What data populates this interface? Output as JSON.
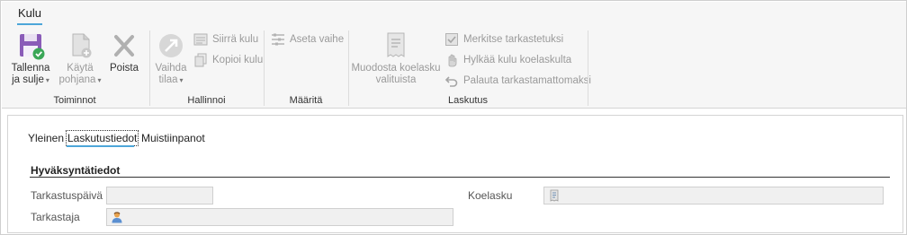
{
  "ribbon": {
    "tab": "Kulu",
    "groups": {
      "toiminnot": {
        "label": "Toiminnot",
        "save": {
          "line1": "Tallenna",
          "line2": "ja sulje"
        },
        "template": {
          "line1": "Käytä",
          "line2": "pohjana"
        },
        "delete": {
          "line1": "Poista"
        }
      },
      "hallinnoi": {
        "label": "Hallinnoi",
        "change_state": {
          "line1": "Vaihda",
          "line2": "tilaa"
        },
        "move": "Siirrä kulu",
        "copy": "Kopioi kulu"
      },
      "maarita": {
        "label": "Määritä",
        "set_phase": "Aseta vaihe"
      },
      "laskutus": {
        "label": "Laskutus",
        "create_draft": {
          "line1": "Muodosta koelasku",
          "line2": "valituista"
        },
        "mark_checked": "Merkitse tarkastetuksi",
        "reject": "Hylkää kulu koelaskulta",
        "restore": "Palauta tarkastamattomaksi"
      }
    }
  },
  "tabs": [
    {
      "label": "Yleinen"
    },
    {
      "label": "Laskutustiedot"
    },
    {
      "label": "Muistiinpanot"
    }
  ],
  "section": {
    "title": "Hyväksyntätiedot",
    "fields": {
      "tarkastuspaiva": {
        "label": "Tarkastuspäivä",
        "value": ""
      },
      "tarkastaja": {
        "label": "Tarkastaja",
        "value": ""
      },
      "koelasku": {
        "label": "Koelasku",
        "value": ""
      }
    }
  },
  "colors": {
    "accent": "#4da6d9",
    "save_icon": "#7b4fa8",
    "check_green": "#3aa757"
  }
}
